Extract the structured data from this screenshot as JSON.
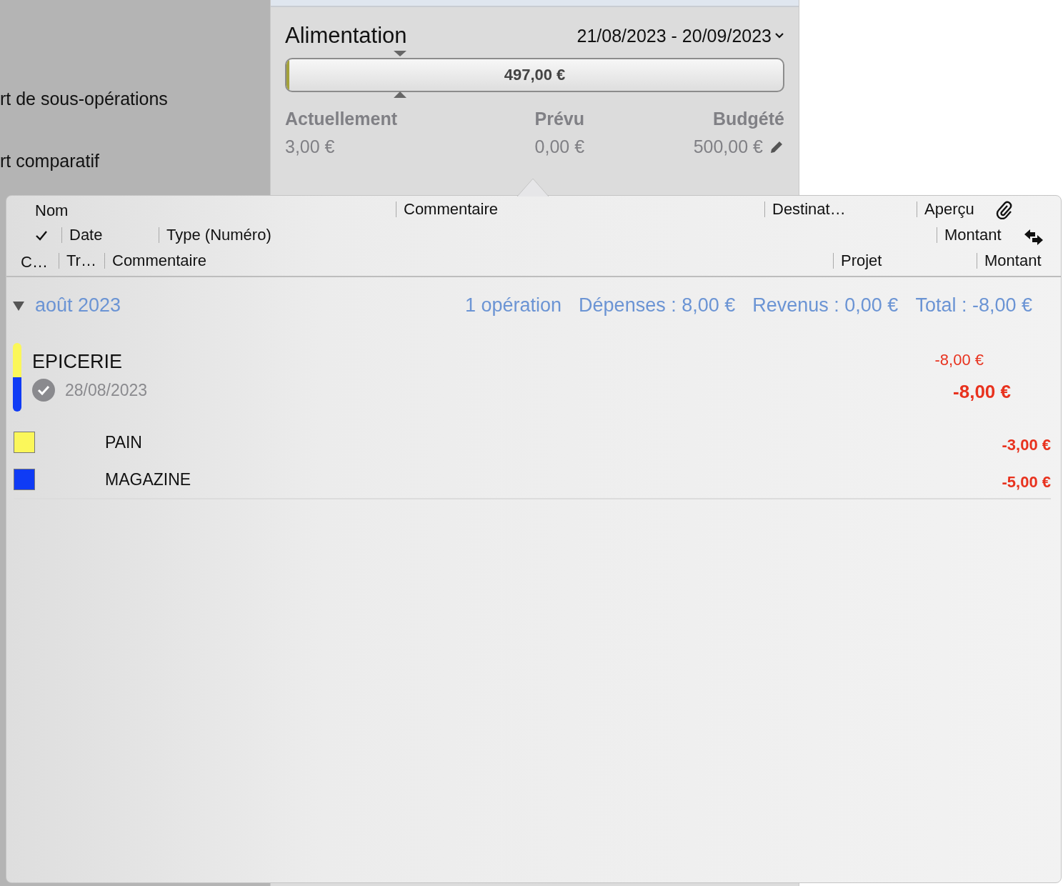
{
  "sidebar": {
    "items": [
      {
        "label": "rt de sous-opérations"
      },
      {
        "label": "rt comparatif"
      }
    ]
  },
  "budget": {
    "title": "Alimentation",
    "period": "21/08/2023 - 20/09/2023",
    "bar_label": "497,00 €",
    "level": 0.006,
    "marker": {
      "level": 0.23
    },
    "stats": [
      {
        "label": "Actuellement",
        "value": "3,00 €",
        "kind": "actual"
      },
      {
        "label": "Prévu",
        "value": "0,00 €",
        "kind": "planned"
      },
      {
        "label": "Budgété",
        "value": "500,00 €",
        "kind": "budgeted"
      }
    ]
  },
  "columns": {
    "row_1": [
      "Nom",
      "Commentaire",
      "Destinat…",
      "Aperçu"
    ],
    "row_2": [
      "Date",
      "Type (Numéro)",
      "Montant"
    ],
    "row_3": [
      "C…",
      "Tr…",
      "Commentaire",
      "Projet",
      "Montant"
    ]
  },
  "group": {
    "title": "août 2023",
    "expanded": true,
    "stats": [
      "1 opération",
      "Dépenses : 8,00 €",
      "Revenus : 0,00 €",
      "Total : -8,00 €"
    ],
    "transaction": {
      "name": "EPICERIE",
      "date": "28/08/2023",
      "checked": true,
      "amount": "-8,00 €",
      "total": "-8,00 €",
      "splits": [
        {
          "name": "PAIN",
          "amount": "-3,00 €",
          "color": "#fbf75a"
        },
        {
          "name": "MAGAZINE",
          "amount": "-5,00 €",
          "color": "#0f3bf5"
        }
      ]
    }
  }
}
